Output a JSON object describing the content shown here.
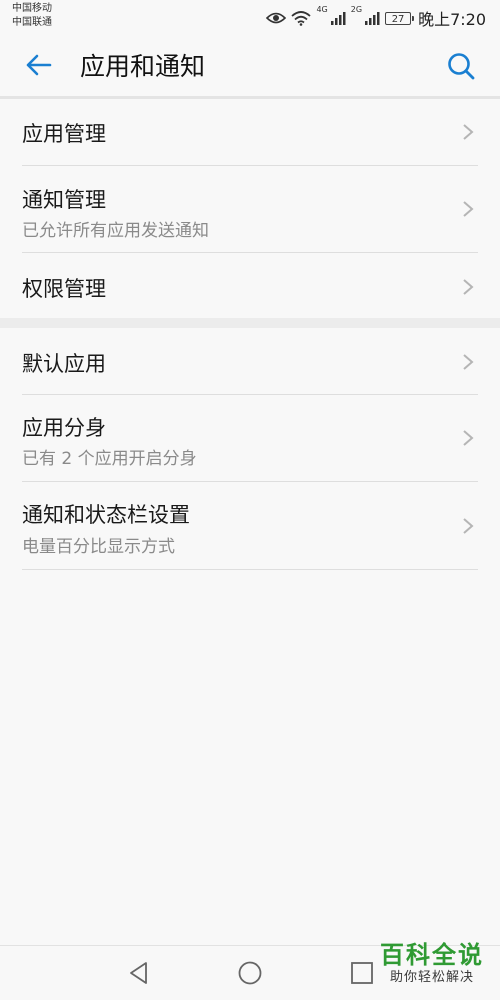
{
  "status_bar": {
    "carrier_1": "中国移动",
    "carrier_2": "中国联通",
    "net_1": "4G",
    "net_2": "2G",
    "battery": "27",
    "time": "晚上7:20"
  },
  "header": {
    "title": "应用和通知"
  },
  "groups": [
    {
      "items": [
        {
          "title": "应用管理",
          "subtitle": ""
        },
        {
          "title": "通知管理",
          "subtitle": "已允许所有应用发送通知"
        },
        {
          "title": "权限管理",
          "subtitle": ""
        }
      ]
    },
    {
      "items": [
        {
          "title": "默认应用",
          "subtitle": ""
        },
        {
          "title": "应用分身",
          "subtitle": "已有 2 个应用开启分身"
        },
        {
          "title": "通知和状态栏设置",
          "subtitle": "电量百分比显示方式"
        }
      ]
    }
  ],
  "watermark": {
    "title": "百科全说",
    "subtitle": "助你轻松解决"
  },
  "colors": {
    "accent": "#1a7fd1",
    "watermark": "#2f9a33",
    "subtitle": "#8a8a8a"
  },
  "icons": {
    "back": "arrow-left-icon",
    "search": "search-icon",
    "chevron": "chevron-right-icon",
    "nav_back": "triangle-back-icon",
    "nav_home": "circle-home-icon",
    "nav_recent": "square-recent-icon"
  }
}
